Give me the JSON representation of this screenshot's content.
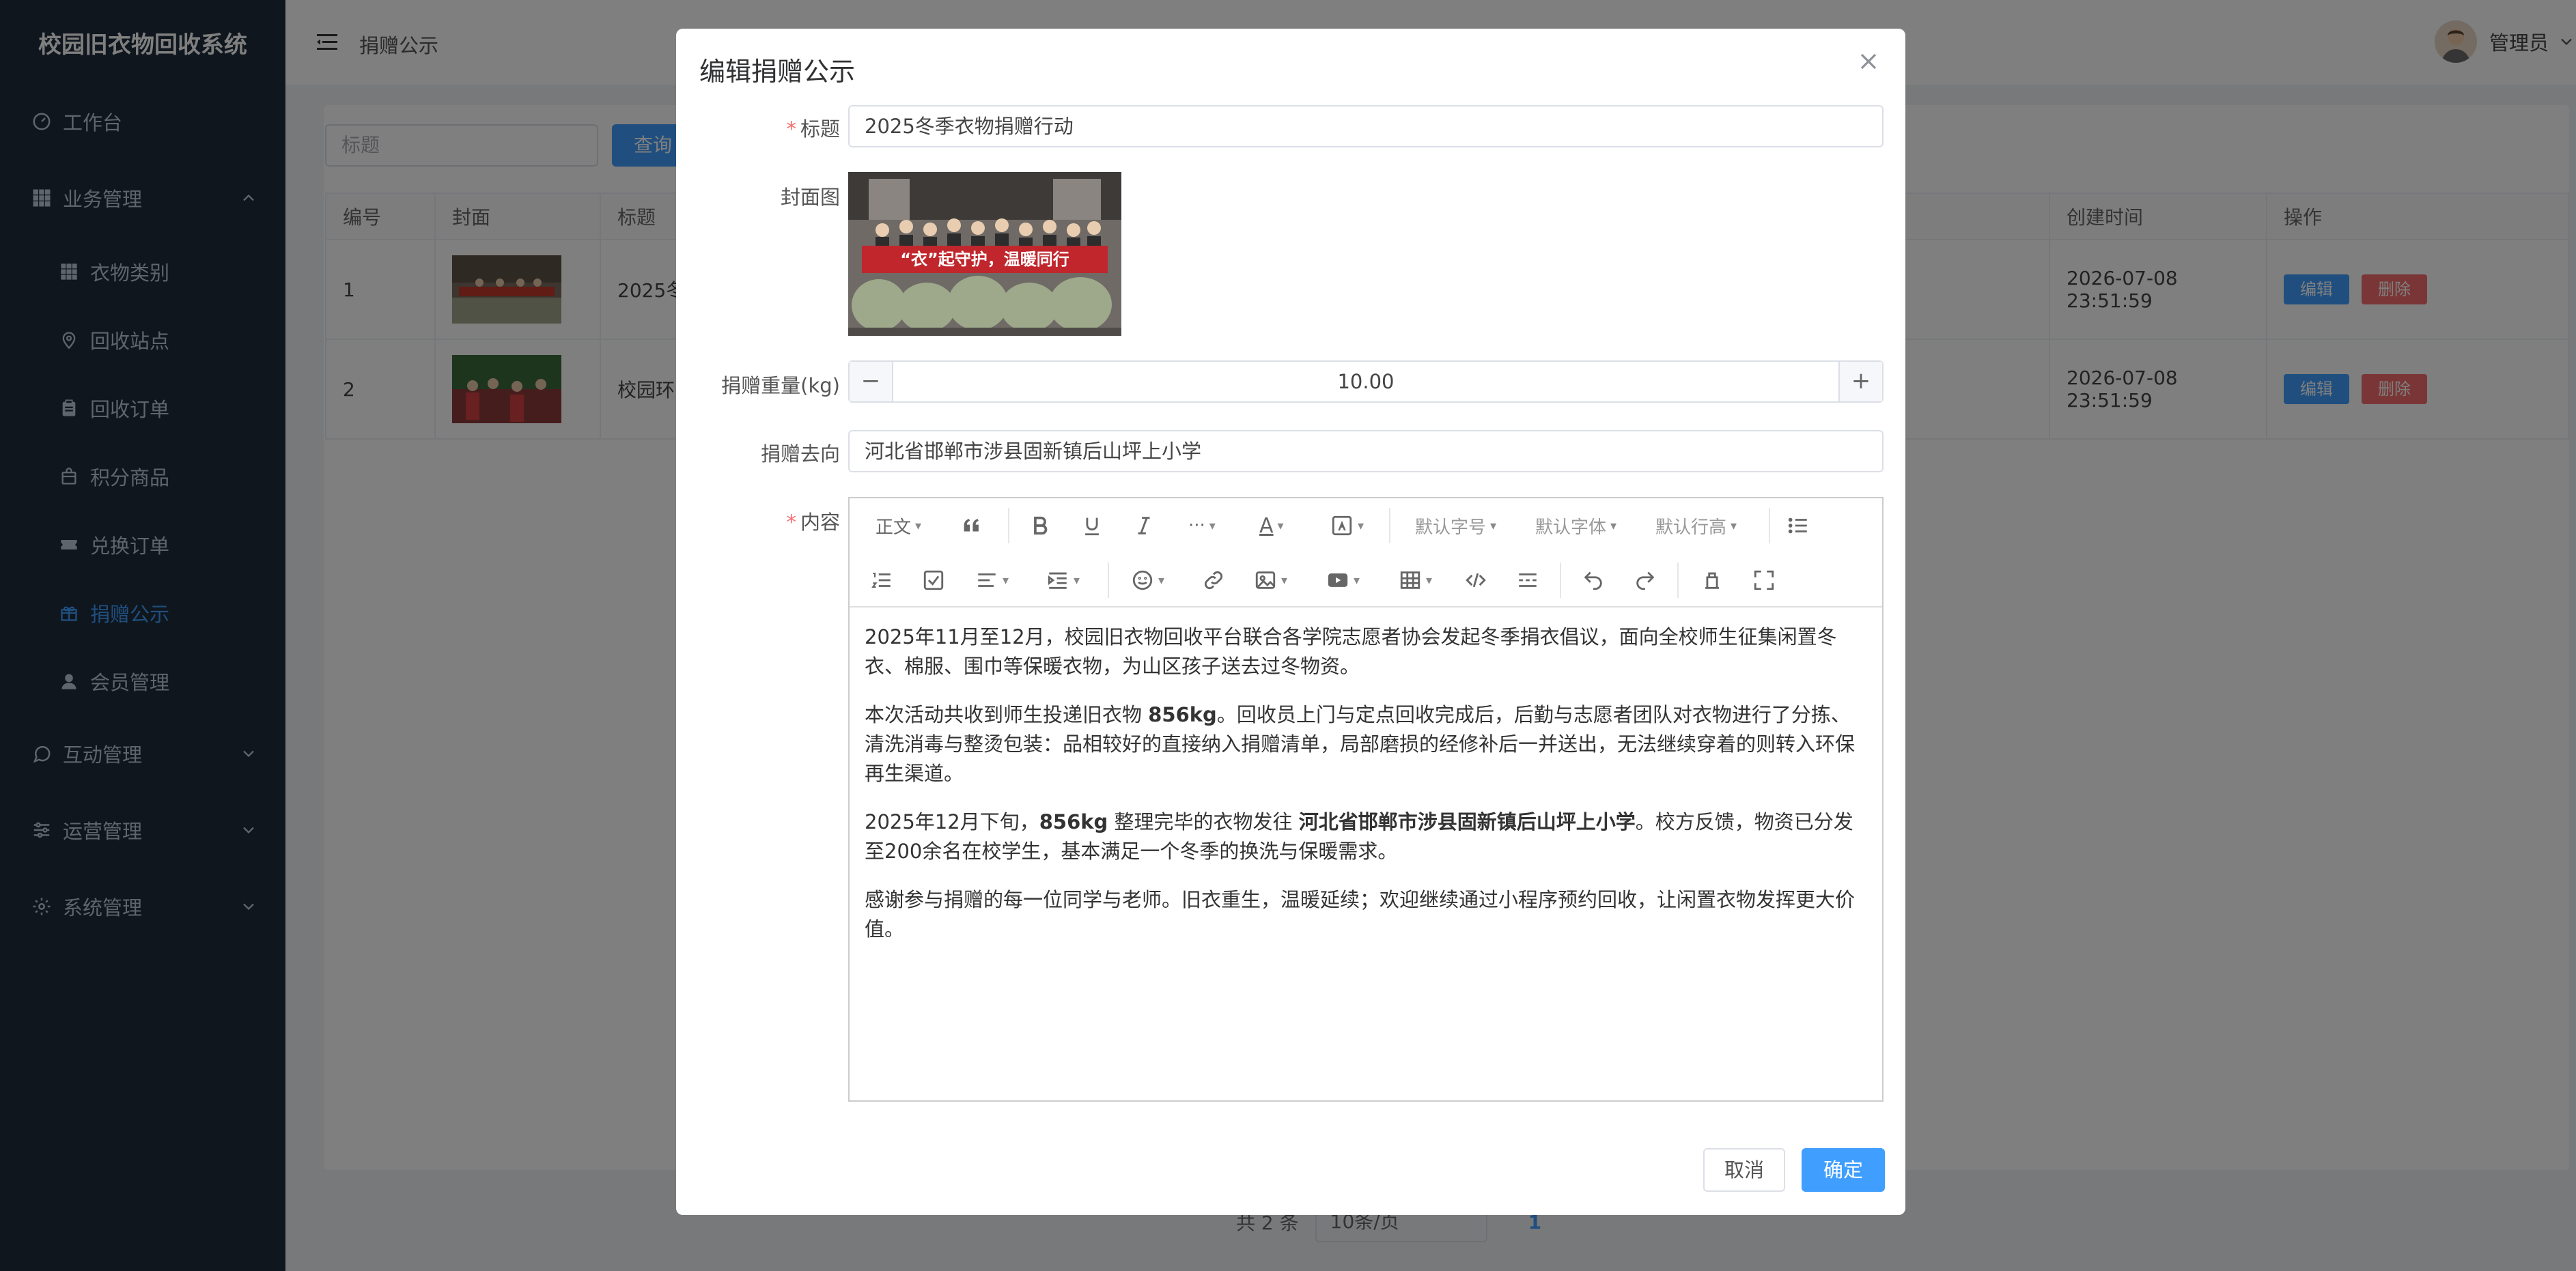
{
  "app": {
    "title": "校园旧衣物回收系统"
  },
  "sidebar": {
    "items": [
      {
        "label": "工作台",
        "icon": "gauge-icon"
      },
      {
        "label": "业务管理",
        "icon": "grid-icon"
      },
      {
        "label": "衣物类别",
        "icon": "grid-icon"
      },
      {
        "label": "回收站点",
        "icon": "location-icon"
      },
      {
        "label": "回收订单",
        "icon": "clipboard-icon"
      },
      {
        "label": "积分商品",
        "icon": "bag-icon"
      },
      {
        "label": "兑换订单",
        "icon": "ticket-icon"
      },
      {
        "label": "捐赠公示",
        "icon": "gift-icon"
      },
      {
        "label": "会员管理",
        "icon": "user-icon"
      },
      {
        "label": "互动管理",
        "icon": "chat-icon"
      },
      {
        "label": "运营管理",
        "icon": "sliders-icon"
      },
      {
        "label": "系统管理",
        "icon": "gear-icon"
      }
    ]
  },
  "header": {
    "breadcrumb": "捐赠公示",
    "user": "管理员"
  },
  "search": {
    "placeholder": "标题",
    "query_label": "查询"
  },
  "table": {
    "headers": [
      "编号",
      "封面",
      "标题",
      "创建时间",
      "操作"
    ],
    "rows": [
      {
        "id": "1",
        "title": "2025冬",
        "created": "2026-07-08 23:51:59"
      },
      {
        "id": "2",
        "title": "校园环",
        "created": "2026-07-08 23:51:59"
      }
    ],
    "edit_label": "编辑",
    "delete_label": "删除"
  },
  "pagination": {
    "total": "共 2 条",
    "page_size": "10条/页",
    "current": "1"
  },
  "dialog": {
    "title": "编辑捐赠公示",
    "fields": {
      "title_label": "标题",
      "title_value": "2025冬季衣物捐赠行动",
      "cover_label": "封面图",
      "cover_banner": "“衣”起守护，温暖同行",
      "weight_label": "捐赠重量(kg)",
      "weight_value": "10.00",
      "destination_label": "捐赠去向",
      "destination_value": "河北省邯郸市涉县固新镇后山坪上小学",
      "content_label": "内容"
    },
    "toolbar": {
      "paragraph": "正文",
      "font_size": "默认字号",
      "font_family": "默认字体",
      "line_height": "默认行高"
    },
    "content": {
      "p1": "2025年11月至12月，校园旧衣物回收平台联合各学院志愿者协会发起冬季捐衣倡议，面向全校师生征集闲置冬衣、棉服、围巾等保暖衣物，为山区孩子送去过冬物资。",
      "p2a": "本次活动共收到师生投递旧衣物 ",
      "p2b": "856kg",
      "p2c": "。回收员上门与定点回收完成后，后勤与志愿者团队对衣物进行了分拣、清洗消毒与整烫包装：品相较好的直接纳入捐赠清单，局部磨损的经修补后一并送出，无法继续穿着的则转入环保再生渠道。",
      "p3a": "2025年12月下旬，",
      "p3b": "856kg",
      "p3c": " 整理完毕的衣物发往 ",
      "p3d": "河北省邯郸市涉县固新镇后山坪上小学",
      "p3e": "。校方反馈，物资已分发至200余名在校学生，基本满足一个冬季的换洗与保暖需求。",
      "p4": "感谢参与捐赠的每一位同学与老师。旧衣重生，温暖延续；欢迎继续通过小程序预约回收，让闲置衣物发挥更大价值。"
    },
    "cancel_label": "取消",
    "ok_label": "确定"
  },
  "colors": {
    "sidebar_bg": "#1f2d3d",
    "primary": "#409eff",
    "danger": "#f56c6c",
    "active_menu": "#409eff"
  }
}
